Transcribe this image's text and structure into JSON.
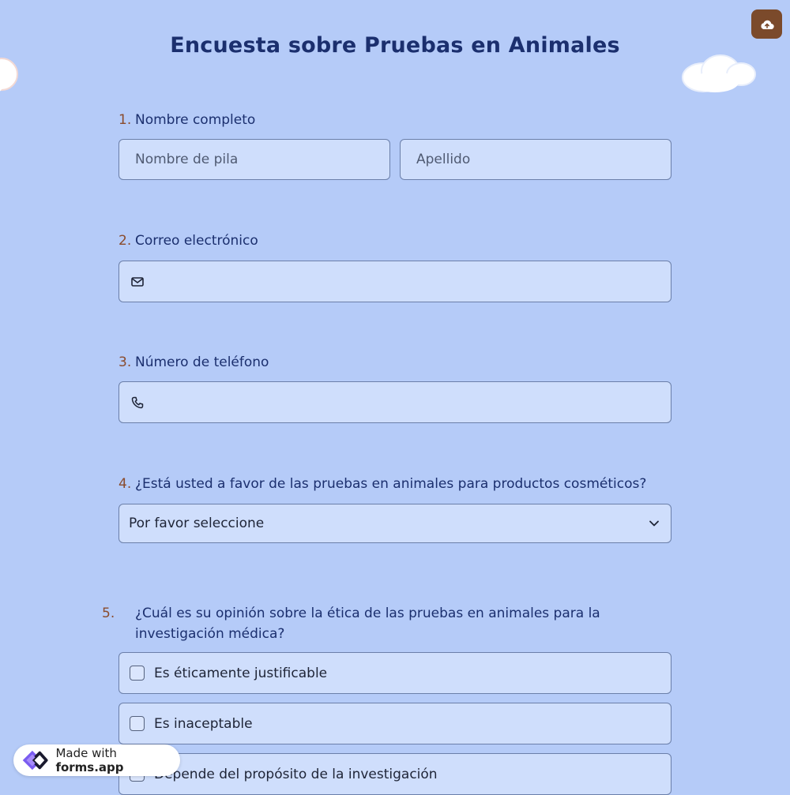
{
  "form": {
    "title": "Encuesta sobre Pruebas en Animales"
  },
  "questions": [
    {
      "number": "1.",
      "label": "Nombre completo",
      "first_placeholder": "Nombre de pila",
      "last_placeholder": "Apellido"
    },
    {
      "number": "2.",
      "label": "Correo electrónico",
      "icon": "mail-icon"
    },
    {
      "number": "3.",
      "label": "Número de teléfono",
      "icon": "phone-icon"
    },
    {
      "number": "4.",
      "label": "¿Está usted a favor de las pruebas en animales para productos cosméticos?",
      "select_value": "Por favor seleccione"
    },
    {
      "number": "5.",
      "label": "¿Cuál es su opinión sobre la ética de las pruebas en animales para la investigación médica?",
      "options": [
        "Es éticamente justificable",
        "Es inaceptable",
        "Depende del propósito de la investigación"
      ]
    }
  ],
  "branding": {
    "made_with": "Made with",
    "brand": "forms.app"
  },
  "colors": {
    "background": "#b5cbf8",
    "field": "#cfdefc",
    "title": "#1b2f6e",
    "number_accent": "#8a4b2c",
    "upload_button": "#7b4a2b"
  }
}
